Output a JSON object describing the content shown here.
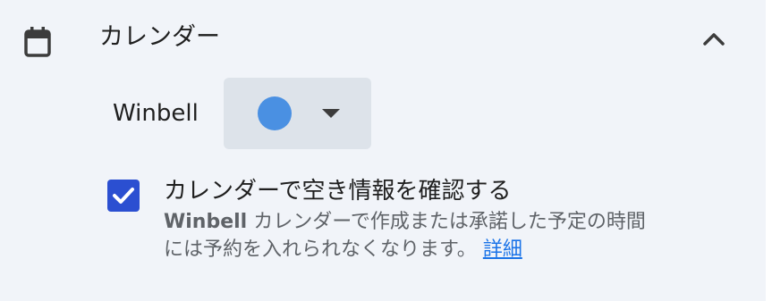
{
  "section": {
    "title": "カレンダー",
    "icon": "calendar-icon",
    "collapse_icon": "chevron-up-icon"
  },
  "calendar_row": {
    "name": "Winbell",
    "selected_color": "#4a90e2",
    "dropdown_icon": "caret-down-icon"
  },
  "availability": {
    "checked": true,
    "checkbox_color": "#2b4fd1",
    "label": "カレンダーで空き情報を確認する",
    "description_bold": "Winbell",
    "description_line1_rest": " カレンダーで作成または承諾した予定の時間",
    "description_line2": "には予約を入れられなくなります。",
    "details_link": "詳細",
    "link_color": "#1a73e8"
  }
}
